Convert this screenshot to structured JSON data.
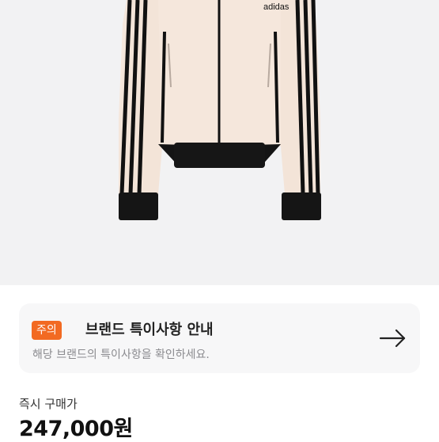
{
  "product": {
    "brand_logo_text": "adidas",
    "image_desc_icon": "jacket-photo"
  },
  "notice": {
    "badge": "주의",
    "title": "브랜드 특이사항 안내",
    "description": "해당 브랜드의 특이사항을 확인하세요.",
    "arrow_icon": "arrow-right-icon",
    "accent_color": "#f26a22"
  },
  "price": {
    "label": "즉시 구매가",
    "value": "247,000원"
  }
}
